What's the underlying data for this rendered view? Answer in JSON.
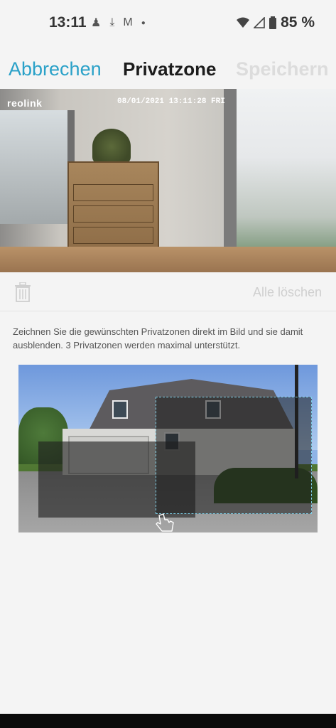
{
  "status_bar": {
    "time": "13:11",
    "notification_icons": [
      "cleaning-robot-icon",
      "download-done-icon",
      "gmail-icon",
      "dot-icon"
    ],
    "battery_percent": "85 %"
  },
  "nav": {
    "cancel_label": "Abbrechen",
    "title": "Privatzone",
    "save_label": "Speichern"
  },
  "camera": {
    "logo": "reolink",
    "timestamp": "08/01/2021 13:11:28 FRI"
  },
  "toolbar": {
    "clear_all_label": "Alle löschen"
  },
  "instructions": "Zeichnen Sie die gewünschten Privatzonen direkt im Bild und sie damit ausblenden. 3 Privatzonen werden maximal unterstützt.",
  "colors": {
    "accent": "#2aa1c8",
    "disabled": "#dcdcdc",
    "zone_border": "#7fd0e8"
  }
}
